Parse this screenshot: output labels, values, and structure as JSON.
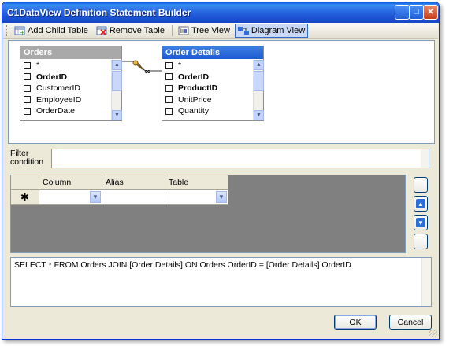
{
  "window": {
    "title": "C1DataView Definition Statement Builder",
    "controls": {
      "minimize": "_",
      "maximize": "□",
      "close": "✕"
    }
  },
  "toolbar": {
    "items": [
      {
        "label": "Add Child Table",
        "icon": "add-child-table-icon"
      },
      {
        "label": "Remove Table",
        "icon": "remove-table-icon"
      },
      {
        "label": "Tree View",
        "icon": "tree-view-icon"
      },
      {
        "label": "Diagram View",
        "icon": "diagram-view-icon",
        "active": true
      }
    ]
  },
  "diagram": {
    "tables": [
      {
        "name": "Orders",
        "header_color": "#a9a9a9",
        "fields": [
          {
            "label": "*",
            "bold": false
          },
          {
            "label": "OrderID",
            "bold": true
          },
          {
            "label": "CustomerID",
            "bold": false
          },
          {
            "label": "EmployeeID",
            "bold": false
          },
          {
            "label": "OrderDate",
            "bold": false
          }
        ]
      },
      {
        "name": "Order Details",
        "header_color": "#2a69d8",
        "fields": [
          {
            "label": "*",
            "bold": false
          },
          {
            "label": "OrderID",
            "bold": true
          },
          {
            "label": "ProductID",
            "bold": true
          },
          {
            "label": "UnitPrice",
            "bold": false
          },
          {
            "label": "Quantity",
            "bold": false
          }
        ]
      }
    ],
    "relation_icon": "key-to-infinity-relation-icon"
  },
  "filter": {
    "label": "Filter condition",
    "value": ""
  },
  "grid": {
    "columns": [
      "Column",
      "Alias",
      "Table"
    ],
    "new_row_marker": "✱",
    "side_buttons": [
      "blank",
      "move-up-icon",
      "move-down-icon",
      "blank"
    ]
  },
  "sql": {
    "text": "SELECT *  FROM Orders JOIN [Order Details] ON Orders.OrderID = [Order Details].OrderID"
  },
  "buttons": {
    "ok": "OK",
    "cancel": "Cancel"
  },
  "colors": {
    "titlebar": "#2563dc",
    "window_bg": "#ece9d8",
    "grid_bg": "#808080",
    "accent_blue": "#2b6ed8"
  }
}
